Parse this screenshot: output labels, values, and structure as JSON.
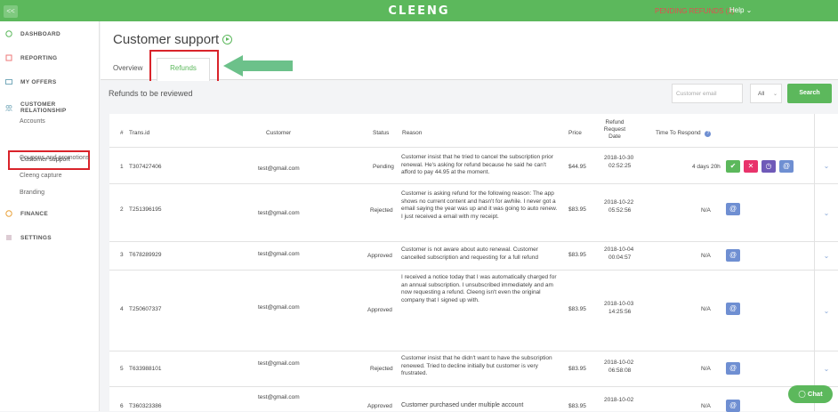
{
  "topbar": {
    "logo": "CLEENG",
    "pending_refunds": "PENDING REFUNDS (1)",
    "help": "Help ⌄",
    "toggle": "<<"
  },
  "sidebar": {
    "dashboard": "DASHBOARD",
    "reporting": "REPORTING",
    "my_offers": "MY OFFERS",
    "customer_relationship": "CUSTOMER RELATIONSHIP",
    "accounts": "Accounts",
    "customer_support": "Customer support",
    "coupons": "Coupons and promotions",
    "cleeng_capture": "Cleeng capture",
    "branding": "Branding",
    "finance": "FINANCE",
    "settings": "SETTINGS"
  },
  "page": {
    "title": "Customer support",
    "tab_overview": "Overview",
    "tab_refunds": "Refunds",
    "section_label": "Refunds to be reviewed",
    "email_placeholder": "Customer email",
    "filter_value": "All",
    "search_label": "Search"
  },
  "table": {
    "headers": {
      "num": "#",
      "trans_id": "Trans.id",
      "customer": "Customer",
      "status": "Status",
      "reason": "Reason",
      "price": "Price",
      "refund_date": "Refund Request Date",
      "time_to_respond": "Time To Respond"
    },
    "rows": [
      {
        "num": "1",
        "id": "T307427406",
        "customer": "test@gmail.com",
        "status": "Pending",
        "reason": "Customer insist that he tried to cancel the subscription prior renewal. He's asking for refund because he said he can't afford to pay 44.95 at the moment.",
        "price": "$44.95",
        "date": "2018-10-30",
        "time": "02:52:25",
        "respond": "4 days 20h"
      },
      {
        "num": "2",
        "id": "T251396195",
        "customer": "test@gmail.com",
        "status": "Rejected",
        "reason": "Customer is asking refund for the following reason: The app shows no current content and hasn't for awhile. I never got a email saying the year was up and it was going to auto renew. I just received a email with my receipt.",
        "price": "$83.95",
        "date": "2018-10-22",
        "time": "05:52:56",
        "respond": "N/A"
      },
      {
        "num": "3",
        "id": "T678289929",
        "customer": "test@gmail.com",
        "status": "Approved",
        "reason": "Customer is not aware about auto renewal. Customer cancelled subscription and requesting for a full refund",
        "price": "$83.95",
        "date": "2018-10-04",
        "time": "00:04:57",
        "respond": "N/A"
      },
      {
        "num": "4",
        "id": "T250607337",
        "customer": "test@gmail.com",
        "status": "Approved",
        "reason": "I received a notice today that I was automatically charged for an annual subscription. I unsubscribed immediately and am now requesting a refund. Cleeng isn't even the original company that I signed up with.",
        "price": "$83.95",
        "date": "2018-10-03",
        "time": "14:25:56",
        "respond": "N/A"
      },
      {
        "num": "5",
        "id": "T633988101",
        "customer": "test@gmail.com",
        "status": "Rejected",
        "reason": "Customer insist that he didn't want to have the subscription renewed. Tried to decline initially but customer is very frustrated.",
        "price": "$83.95",
        "date": "2018-10-02",
        "time": "06:58:08",
        "respond": "N/A"
      },
      {
        "num": "6",
        "id": "T360323386",
        "customer": "test@gmail.com",
        "status": "Approved",
        "reason": "Customer purchased under multiple account",
        "price": "$83.95",
        "date": "2018-10-02",
        "time": "",
        "respond": "N/A"
      }
    ]
  },
  "chat": {
    "label": "Chat"
  },
  "colors": {
    "brand": "#5cb85c",
    "highlight": "#d9232a",
    "approve": "#5cb85c",
    "reject": "#e8336b",
    "clock": "#6f5ab8",
    "email": "#6f8fd2"
  }
}
